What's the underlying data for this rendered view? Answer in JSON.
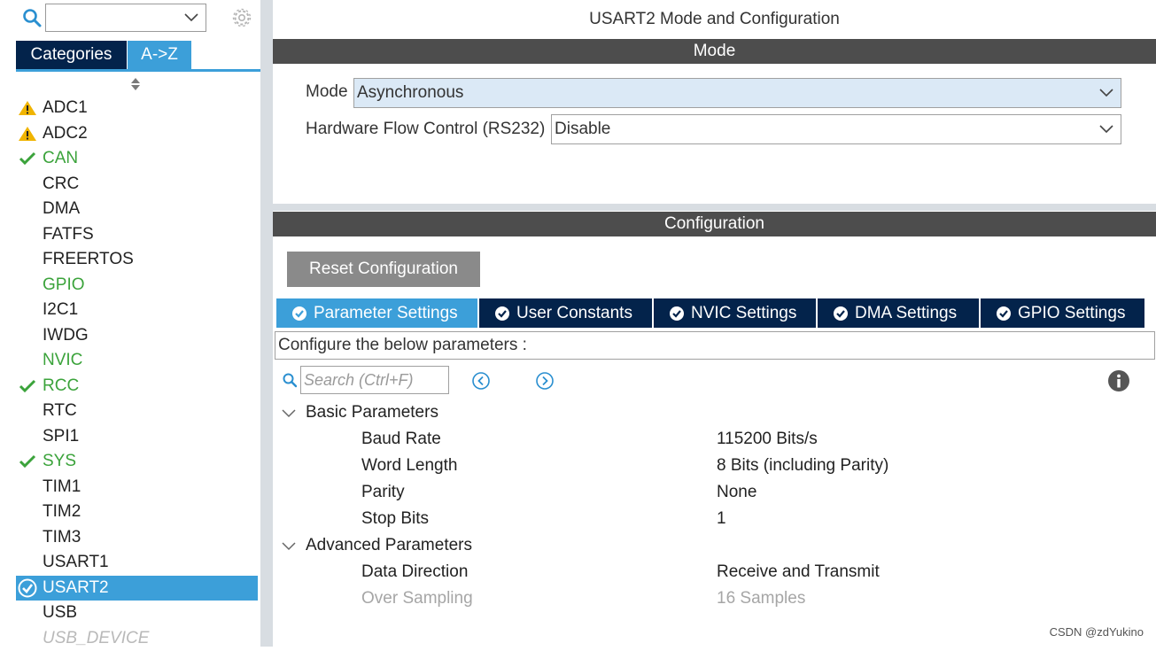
{
  "left_panel": {
    "search_value": "",
    "tabs": [
      {
        "label": "Categories"
      },
      {
        "label": "A->Z"
      }
    ],
    "items": [
      {
        "label": "ADC1",
        "status": "warning"
      },
      {
        "label": "ADC2",
        "status": "warning"
      },
      {
        "label": "CAN",
        "status": "ok"
      },
      {
        "label": "CRC",
        "status": "none"
      },
      {
        "label": "DMA",
        "status": "none"
      },
      {
        "label": "FATFS",
        "status": "none"
      },
      {
        "label": "FREERTOS",
        "status": "none"
      },
      {
        "label": "GPIO",
        "status": "green"
      },
      {
        "label": "I2C1",
        "status": "none"
      },
      {
        "label": "IWDG",
        "status": "none"
      },
      {
        "label": "NVIC",
        "status": "green"
      },
      {
        "label": "RCC",
        "status": "ok"
      },
      {
        "label": "RTC",
        "status": "none"
      },
      {
        "label": "SPI1",
        "status": "none"
      },
      {
        "label": "SYS",
        "status": "ok"
      },
      {
        "label": "TIM1",
        "status": "none"
      },
      {
        "label": "TIM2",
        "status": "none"
      },
      {
        "label": "TIM3",
        "status": "none"
      },
      {
        "label": "USART1",
        "status": "none"
      },
      {
        "label": "USART2",
        "status": "selected"
      },
      {
        "label": "USB",
        "status": "none"
      },
      {
        "label": "USB_DEVICE",
        "status": "disabled"
      }
    ]
  },
  "window_title": "USART2 Mode and Configuration",
  "mode_section": {
    "header": "Mode",
    "mode_label": "Mode",
    "mode_value": "Asynchronous",
    "flow_label": "Hardware Flow Control (RS232)",
    "flow_value": "Disable"
  },
  "config_section": {
    "header": "Configuration",
    "reset_label": "Reset Configuration",
    "tabs": [
      {
        "label": "Parameter Settings"
      },
      {
        "label": "User Constants"
      },
      {
        "label": "NVIC Settings"
      },
      {
        "label": "DMA Settings"
      },
      {
        "label": "GPIO Settings"
      }
    ],
    "description": "Configure the below parameters :",
    "search_placeholder": "Search (Ctrl+F)",
    "groups": [
      {
        "name": "Basic Parameters",
        "params": [
          {
            "name": "Baud Rate",
            "value": "115200 Bits/s"
          },
          {
            "name": "Word Length",
            "value": "8 Bits (including Parity)"
          },
          {
            "name": "Parity",
            "value": "None"
          },
          {
            "name": "Stop Bits",
            "value": "1"
          }
        ]
      },
      {
        "name": "Advanced Parameters",
        "params": [
          {
            "name": "Data Direction",
            "value": "Receive and Transmit"
          },
          {
            "name": "Over Sampling",
            "value": "16 Samples"
          }
        ]
      }
    ]
  },
  "watermark": "CSDN @zdYukino",
  "colors": {
    "accent_blue": "#3c9fd9",
    "dark_navy": "#03234b",
    "section_gray": "#4d4d4d",
    "ok_green": "#3ba33b",
    "warning_yellow": "#f0b400"
  }
}
